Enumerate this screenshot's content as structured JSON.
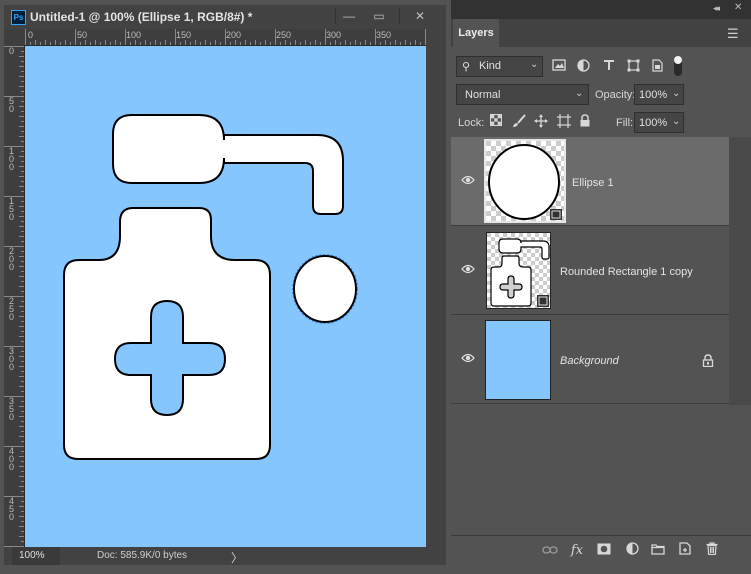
{
  "document": {
    "title": "Untitled-1 @ 100% (Ellipse 1, RGB/8#) *",
    "app_badge": "Ps",
    "window_buttons": {
      "minimize": "—",
      "restore": "▭",
      "close": "✕"
    },
    "ruler_top_labels": [
      "0",
      "50",
      "100",
      "150",
      "200",
      "250",
      "300",
      "350"
    ],
    "ruler_left_labels": [
      "0",
      "50",
      "100",
      "150",
      "200",
      "250",
      "300",
      "350",
      "400",
      "450"
    ],
    "canvas_color": "#85c6ff",
    "status": {
      "zoom": "100%",
      "doc_info": "Doc: 585.9K/0 bytes",
      "arrow": "〉"
    }
  },
  "layers_panel": {
    "tab_label": "Layers",
    "collapse_glyph": "◂◂",
    "close_glyph": "✕",
    "menu_glyph": "☰",
    "filter": {
      "kind_label": "Kind",
      "search_glyph": "⚲",
      "chevron": "⌄"
    },
    "blend_mode": "Normal",
    "opacity_label": "Opacity:",
    "opacity_value": "100%",
    "lock_label": "Lock:",
    "fill_label": "Fill:",
    "fill_value": "100%",
    "chevron": "⌄",
    "layers": [
      {
        "name": "Ellipse 1",
        "selected": true,
        "visible": true
      },
      {
        "name": "Rounded Rectangle 1 copy",
        "selected": false,
        "visible": true
      },
      {
        "name": "Background",
        "selected": false,
        "visible": true,
        "locked": true
      }
    ],
    "bottom_icons": [
      "link-icon",
      "fx-icon",
      "mask-icon",
      "adjustment-icon",
      "folder-icon",
      "new-layer-icon",
      "trash-icon"
    ],
    "fx_label": "fx"
  }
}
